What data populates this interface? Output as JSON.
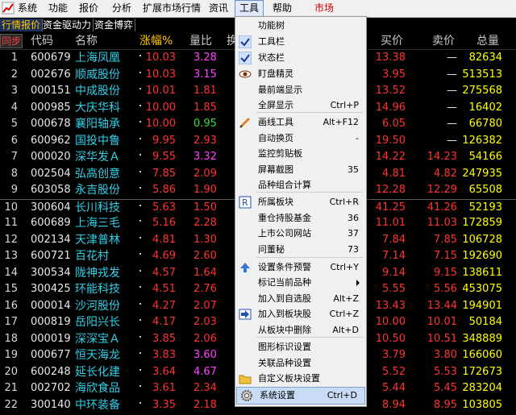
{
  "menubar": {
    "items": [
      "系统",
      "功能",
      "报价",
      "分析",
      "扩展市场行情",
      "资讯",
      "工具",
      "帮助",
      "市场"
    ]
  },
  "tabs": [
    "行情报价",
    "资金驱动力",
    "资金博弈"
  ],
  "header": {
    "sync": "同步",
    "code": "代码",
    "name": "名称",
    "change": "涨幅%",
    "volume_ratio": "量比",
    "col_cut": "换",
    "buy": "买价",
    "sell": "卖价",
    "total": "总量"
  },
  "stocks": [
    {
      "n": "1",
      "code": "600679",
      "name": "上海凤凰",
      "chg": "10.03",
      "vr": "3.28",
      "vrc": "#ff40ff",
      "buy": "13.38",
      "sell": "—",
      "tot": "82634"
    },
    {
      "n": "2",
      "code": "002676",
      "name": "顺威股份",
      "chg": "10.03",
      "vr": "3.15",
      "vrc": "#ff40ff",
      "buy": "3.95",
      "sell": "—",
      "tot": "513513"
    },
    {
      "n": "3",
      "code": "000151",
      "name": "中成股份",
      "chg": "10.01",
      "vr": "1.81",
      "vrc": "#ff3232",
      "buy": "13.52",
      "sell": "—",
      "tot": "275568"
    },
    {
      "n": "4",
      "code": "000985",
      "name": "大庆华科",
      "chg": "10.00",
      "vr": "1.85",
      "vrc": "#ff3232",
      "buy": "14.96",
      "sell": "—",
      "tot": "16402"
    },
    {
      "n": "5",
      "code": "000678",
      "name": "襄阳轴承",
      "chg": "10.00",
      "vr": "0.95",
      "vrc": "#30e030",
      "buy": "6.05",
      "sell": "—",
      "tot": "66780"
    },
    {
      "n": "6",
      "code": "600962",
      "name": "国投中鲁",
      "chg": "9.95",
      "vr": "2.93",
      "vrc": "#ff3232",
      "buy": "19.50",
      "sell": "—",
      "tot": "126382"
    },
    {
      "n": "7",
      "code": "000020",
      "name": "深华发Ａ",
      "chg": "9.55",
      "vr": "3.32",
      "vrc": "#ff40ff",
      "buy": "14.22",
      "sell": "14.23",
      "tot": "54166"
    },
    {
      "n": "8",
      "code": "002504",
      "name": "弘高创意",
      "chg": "7.85",
      "vr": "2.09",
      "vrc": "#ff3232",
      "buy": "4.81",
      "sell": "4.82",
      "tot": "247935"
    },
    {
      "n": "9",
      "code": "603058",
      "name": "永吉股份",
      "chg": "5.86",
      "vr": "1.90",
      "vrc": "#ff3232",
      "buy": "12.28",
      "sell": "12.29",
      "tot": "65508"
    },
    {
      "n": "10",
      "code": "300604",
      "name": "长川科技",
      "chg": "5.63",
      "vr": "1.50",
      "vrc": "#ff3232",
      "buy": "41.25",
      "sell": "41.26",
      "tot": "52193"
    },
    {
      "n": "11",
      "code": "600689",
      "name": "上海三毛",
      "chg": "5.16",
      "vr": "2.28",
      "vrc": "#ff3232",
      "buy": "11.01",
      "sell": "11.03",
      "tot": "172859"
    },
    {
      "n": "12",
      "code": "002134",
      "name": "天津普林",
      "chg": "4.81",
      "vr": "1.30",
      "vrc": "#ff3232",
      "buy": "7.84",
      "sell": "7.85",
      "tot": "106728"
    },
    {
      "n": "13",
      "code": "600721",
      "name": "百花村",
      "chg": "4.69",
      "vr": "2.60",
      "vrc": "#ff3232",
      "buy": "7.14",
      "sell": "7.15",
      "tot": "192690"
    },
    {
      "n": "14",
      "code": "300534",
      "name": "陇神戎发",
      "chg": "4.57",
      "vr": "1.64",
      "vrc": "#ff3232",
      "buy": "9.14",
      "sell": "9.15",
      "tot": "138611"
    },
    {
      "n": "15",
      "code": "300425",
      "name": "环能科技",
      "chg": "4.51",
      "vr": "2.76",
      "vrc": "#ff3232",
      "buy": "5.55",
      "sell": "5.56",
      "tot": "453075"
    },
    {
      "n": "16",
      "code": "000014",
      "name": "沙河股份",
      "chg": "4.27",
      "vr": "2.07",
      "vrc": "#ff3232",
      "buy": "13.43",
      "sell": "13.44",
      "tot": "194901"
    },
    {
      "n": "17",
      "code": "000819",
      "name": "岳阳兴长",
      "chg": "4.17",
      "vr": "2.03",
      "vrc": "#ff3232",
      "buy": "10.00",
      "sell": "10.01",
      "tot": "50184"
    },
    {
      "n": "18",
      "code": "000019",
      "name": "深深宝Ａ",
      "chg": "3.85",
      "vr": "2.06",
      "vrc": "#ff3232",
      "buy": "10.50",
      "sell": "10.51",
      "tot": "348889"
    },
    {
      "n": "19",
      "code": "000677",
      "name": "恒天海龙",
      "chg": "3.83",
      "vr": "3.60",
      "vrc": "#ff40ff",
      "buy": "3.79",
      "sell": "3.80",
      "tot": "166060"
    },
    {
      "n": "20",
      "code": "600248",
      "name": "延长化建",
      "chg": "3.64",
      "vr": "4.67",
      "vrc": "#ff40ff",
      "buy": "5.52",
      "sell": "5.53",
      "tot": "172673"
    },
    {
      "n": "21",
      "code": "002702",
      "name": "海欣食品",
      "chg": "3.61",
      "vr": "2.34",
      "vrc": "#ff3232",
      "buy": "5.44",
      "sell": "5.45",
      "tot": "283204"
    },
    {
      "n": "22",
      "code": "300140",
      "name": "中环装备",
      "chg": "3.35",
      "vr": "2.18",
      "vrc": "#ff3232",
      "buy": "8.94",
      "sell": "8.95",
      "tot": "103805"
    }
  ],
  "menu": {
    "items": [
      {
        "label": "功能树",
        "shortcut": "",
        "icon": ""
      },
      {
        "label": "工具栏",
        "shortcut": "",
        "icon": "check-icon"
      },
      {
        "label": "状态栏",
        "shortcut": "",
        "icon": "check-icon"
      },
      {
        "label": "盯盘精灵",
        "shortcut": "",
        "icon": "eye-icon"
      },
      {
        "label": "最前端显示",
        "shortcut": "",
        "icon": ""
      },
      {
        "label": "全屏显示",
        "shortcut": "Ctrl+P",
        "icon": ""
      },
      {
        "label": "画线工具",
        "shortcut": "Alt+F12",
        "icon": "pencil-icon"
      },
      {
        "label": "自动换页",
        "shortcut": "-",
        "icon": ""
      },
      {
        "label": "监控剪贴板",
        "shortcut": "",
        "icon": ""
      },
      {
        "label": "屏幕截图",
        "shortcut": "35",
        "icon": ""
      },
      {
        "label": "品种组合计算",
        "shortcut": "",
        "icon": ""
      },
      {
        "label": "所属板块",
        "shortcut": "Ctrl+R",
        "icon": "r-icon"
      },
      {
        "label": "重仓持股基金",
        "shortcut": "36",
        "icon": ""
      },
      {
        "label": "上市公司网站",
        "shortcut": "37",
        "icon": ""
      },
      {
        "label": "问董秘",
        "shortcut": "73",
        "icon": ""
      },
      {
        "label": "设置条件预警",
        "shortcut": "Ctrl+Y",
        "icon": "alert-icon"
      },
      {
        "label": "标记当前品种",
        "shortcut": "",
        "icon": ""
      },
      {
        "label": "加入到自选股",
        "shortcut": "Alt+Z",
        "icon": ""
      },
      {
        "label": "加入到板块股",
        "shortcut": "Ctrl+Z",
        "icon": "add-block-icon"
      },
      {
        "label": "从板块中删除",
        "shortcut": "Alt+D",
        "icon": ""
      },
      {
        "label": "图形标识设置",
        "shortcut": "",
        "icon": ""
      },
      {
        "label": "关联品种设置",
        "shortcut": "",
        "icon": ""
      },
      {
        "label": "自定义板块设置",
        "shortcut": "",
        "icon": "folder-icon"
      },
      {
        "label": "系统设置",
        "shortcut": "Ctrl+D",
        "icon": "settings-icon"
      }
    ]
  }
}
